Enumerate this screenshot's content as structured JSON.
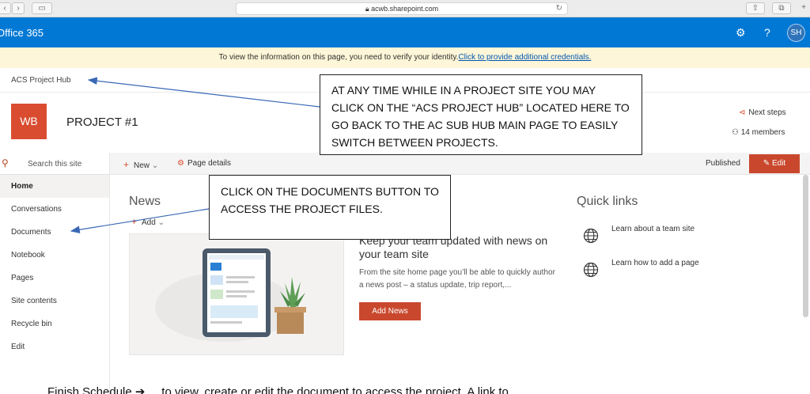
{
  "browser": {
    "url": "acwb.sharepoint.com",
    "lock_icon": "lock-icon"
  },
  "suite": {
    "brand": "Office 365",
    "avatar_initials": "SH",
    "accent": "#0078d4"
  },
  "banner": {
    "text": "To view the information on this page, you need to verify your identity.",
    "link": "Click to provide additional credentials."
  },
  "hub": {
    "label": "ACS Project Hub"
  },
  "site": {
    "logo_text": "WB",
    "logo_color": "#d94c30",
    "title": "PROJECT #1",
    "next_steps": "Next steps",
    "members": "14 members"
  },
  "leftnav": {
    "search_placeholder": "Search this site",
    "items": [
      {
        "label": "Home"
      },
      {
        "label": "Conversations"
      },
      {
        "label": "Documents"
      },
      {
        "label": "Notebook"
      },
      {
        "label": "Pages"
      },
      {
        "label": "Site contents"
      },
      {
        "label": "Recycle bin"
      },
      {
        "label": "Edit"
      }
    ]
  },
  "cmdbar": {
    "new": "New",
    "page_details": "Page details",
    "status": "Published",
    "edit": "Edit"
  },
  "news": {
    "heading": "News",
    "add": "Add",
    "headline": "Keep your team updated with news on your team site",
    "description": "From the site home page you’ll be able to quickly author a news post – a status update, trip report,...",
    "button": "Add News"
  },
  "quick_links": {
    "heading": "Quick links",
    "items": [
      {
        "label": "Learn about a team site"
      },
      {
        "label": "Learn how to add a page"
      }
    ]
  },
  "callouts": {
    "hub": "AT ANY TIME WHILE IN A PROJECT SITE YOU MAY CLICK ON THE “ACS PROJECT HUB” LOCATED HERE TO GO BACK TO THE AC SUB HUB MAIN PAGE TO EASILY SWITCH BETWEEN PROJECTS.",
    "documents": "CLICK ON THE DOCUMENTS BUTTON TO ACCESS THE PROJECT FILES."
  },
  "bottom_text": "Finish Schedule ➔ ... to view, create or edit the document to access the project. A link to..."
}
